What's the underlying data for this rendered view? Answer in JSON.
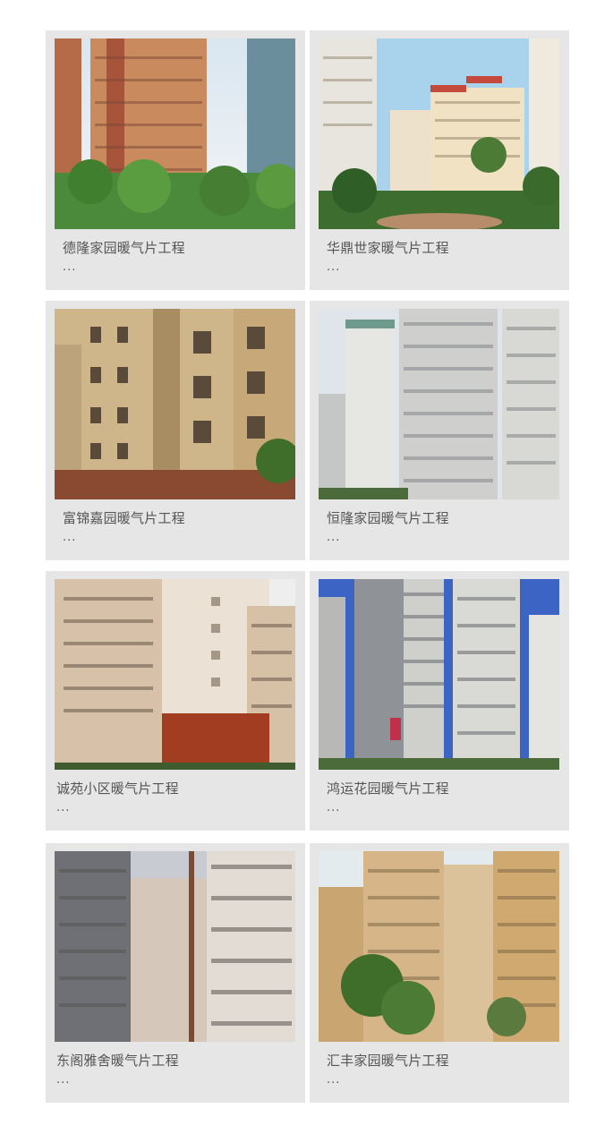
{
  "projects": [
    {
      "title": "德隆家园暖气片工程",
      "more": "...",
      "image": "high-rise-residential-photo"
    },
    {
      "title": "华鼎世家暖气片工程",
      "more": "...",
      "image": "residential-complex-garden-photo"
    },
    {
      "title": "富锦嘉园暖气片工程",
      "more": "...",
      "image": "tan-brick-apartment-photo"
    },
    {
      "title": "恒隆家园暖气片工程",
      "more": "...",
      "image": "white-high-rise-photo"
    },
    {
      "title": "诚苑小区暖气片工程",
      "more": "...",
      "image": "tower-with-red-base-photo"
    },
    {
      "title": "鸿运花园暖气片工程",
      "more": "...",
      "image": "balcony-tower-blue-sky-photo"
    },
    {
      "title": "东阁雅舍暖气片工程",
      "more": "...",
      "image": "grey-apartment-blocks-photo"
    },
    {
      "title": "汇丰家园暖气片工程",
      "more": "...",
      "image": "beige-towers-trees-photo"
    }
  ]
}
